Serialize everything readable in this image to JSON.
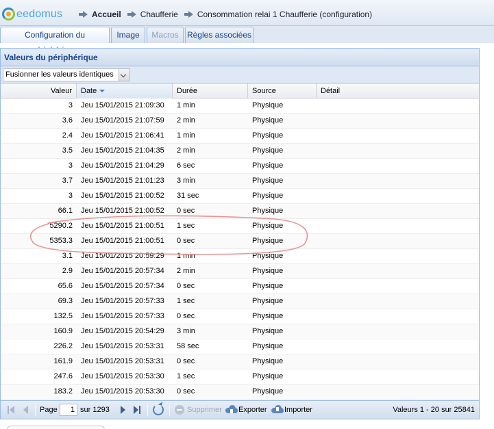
{
  "header": {
    "logo_text": "eedomus",
    "breadcrumb": [
      "Accueil",
      "Chaufferie",
      "Consommation relai 1 Chaufferie (configuration)"
    ]
  },
  "tabs": [
    {
      "label": "Configuration du périphérique",
      "state": "active"
    },
    {
      "label": "Image",
      "state": "normal"
    },
    {
      "label": "Macros",
      "state": "disabled"
    },
    {
      "label": "Règles associées",
      "state": "normal"
    }
  ],
  "panel": {
    "title": "Valeurs du périphérique",
    "filter_selected": "Fusionner les valeurs identiques"
  },
  "grid": {
    "columns": [
      "Valeur",
      "Date",
      "Durée",
      "Source",
      "Détail"
    ],
    "sorted_column": "Date",
    "rows": [
      [
        "3",
        "Jeu 15/01/2015 21:09:30",
        "1 min",
        "Physique",
        ""
      ],
      [
        "3.6",
        "Jeu 15/01/2015 21:07:59",
        "2 min",
        "Physique",
        ""
      ],
      [
        "2.4",
        "Jeu 15/01/2015 21:06:41",
        "1 min",
        "Physique",
        ""
      ],
      [
        "3.5",
        "Jeu 15/01/2015 21:04:35",
        "2 min",
        "Physique",
        ""
      ],
      [
        "3",
        "Jeu 15/01/2015 21:04:29",
        "6 sec",
        "Physique",
        ""
      ],
      [
        "3.7",
        "Jeu 15/01/2015 21:01:23",
        "3 min",
        "Physique",
        ""
      ],
      [
        "3",
        "Jeu 15/01/2015 21:00:52",
        "31 sec",
        "Physique",
        ""
      ],
      [
        "66.1",
        "Jeu 15/01/2015 21:00:52",
        "0 sec",
        "Physique",
        ""
      ],
      [
        "5290.2",
        "Jeu 15/01/2015 21:00:51",
        "1 sec",
        "Physique",
        ""
      ],
      [
        "5353.3",
        "Jeu 15/01/2015 21:00:51",
        "0 sec",
        "Physique",
        ""
      ],
      [
        "3.1",
        "Jeu 15/01/2015 20:59:29",
        "1 min",
        "Physique",
        ""
      ],
      [
        "2.9",
        "Jeu 15/01/2015 20:57:34",
        "2 min",
        "Physique",
        ""
      ],
      [
        "65.6",
        "Jeu 15/01/2015 20:57:34",
        "0 sec",
        "Physique",
        ""
      ],
      [
        "69.3",
        "Jeu 15/01/2015 20:57:33",
        "1 sec",
        "Physique",
        ""
      ],
      [
        "132.5",
        "Jeu 15/01/2015 20:57:33",
        "0 sec",
        "Physique",
        ""
      ],
      [
        "160.9",
        "Jeu 15/01/2015 20:54:29",
        "3 min",
        "Physique",
        ""
      ],
      [
        "226.2",
        "Jeu 15/01/2015 20:53:31",
        "58 sec",
        "Physique",
        ""
      ],
      [
        "161.9",
        "Jeu 15/01/2015 20:53:31",
        "0 sec",
        "Physique",
        ""
      ],
      [
        "247.6",
        "Jeu 15/01/2015 20:53:30",
        "1 sec",
        "Physique",
        ""
      ],
      [
        "183.2",
        "Jeu 15/01/2015 20:53:30",
        "0 sec",
        "Physique",
        ""
      ]
    ]
  },
  "pager": {
    "page_label": "Page",
    "page_value": "1",
    "of_label": "sur 1293",
    "delete_label": "Supprimer",
    "export_label": "Exporter",
    "import_label": "Importer",
    "summary": "Valeurs 1 - 20 sur 25841"
  },
  "colors": {
    "title_blue": "#15428b",
    "border_blue": "#99bbe8",
    "annotation_red": "#e58a8a"
  }
}
